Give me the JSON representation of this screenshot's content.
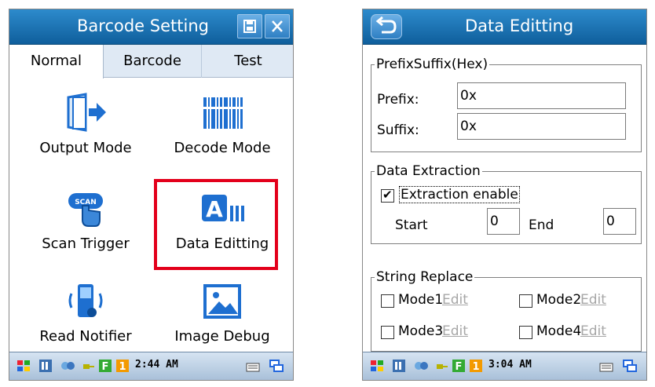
{
  "left": {
    "title": "Barcode Setting",
    "tabs": [
      "Normal",
      "Barcode",
      "Test"
    ],
    "tiles": [
      {
        "label": "Output Mode",
        "icon": "output-mode-icon"
      },
      {
        "label": "Decode Mode",
        "icon": "barcode-icon"
      },
      {
        "label": "Scan Trigger",
        "icon": "scan-hand-icon"
      },
      {
        "label": "Data Editting",
        "icon": "data-edit-icon"
      },
      {
        "label": "Read Notifier",
        "icon": "phone-notifier-icon"
      },
      {
        "label": "Image Debug",
        "icon": "image-icon"
      }
    ],
    "taskbar_time": "2:44 AM",
    "highlight_color": "#e3001b"
  },
  "right": {
    "title": "Data Editting",
    "prefix_group": {
      "legend": "PrefixSuffix(Hex)",
      "prefix_label": "Prefix:",
      "prefix_value": "0x",
      "suffix_label": "Suffix:",
      "suffix_value": "0x"
    },
    "extract_group": {
      "legend": "Data Extraction",
      "enable_label": "Extraction enable",
      "enabled": true,
      "start_label": "Start",
      "start_value": "0",
      "end_label": "End",
      "end_value": "0"
    },
    "replace_group": {
      "legend": "String Replace",
      "modes": [
        "Mode1",
        "Mode2",
        "Mode3",
        "Mode4"
      ],
      "edit_label": "Edit"
    },
    "taskbar_time": "3:04 AM"
  },
  "colors": {
    "title_bar": "#1a6fb0",
    "accent_blue": "#1e6fd0"
  }
}
